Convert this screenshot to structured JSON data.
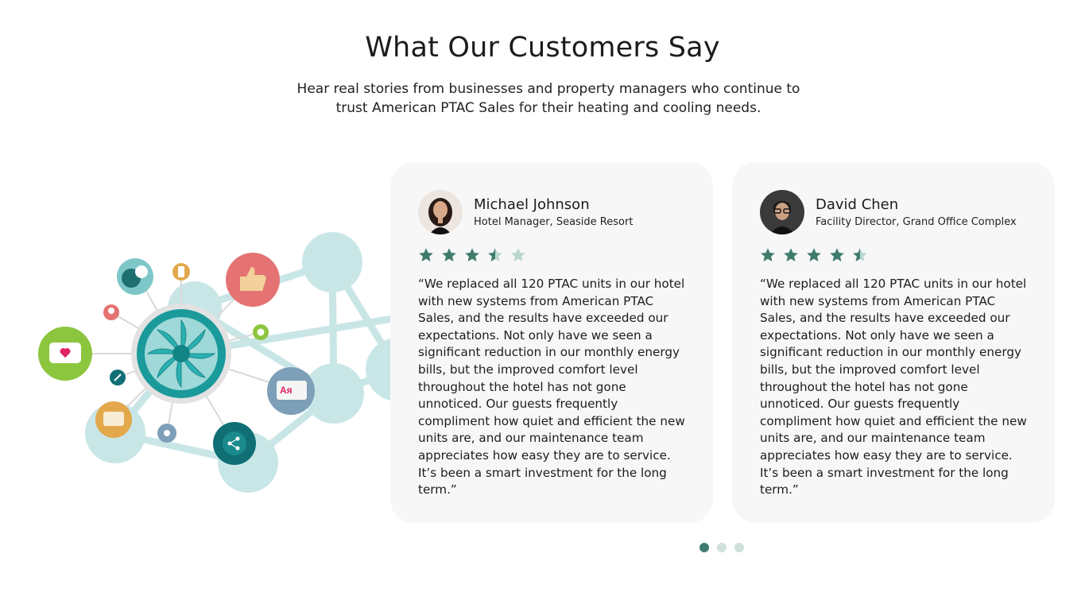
{
  "section": {
    "title": "What Our Customers Say",
    "subtitle": "Hear real stories from businesses and property managers who continue to trust American PTAC Sales for their heating and cooling needs."
  },
  "illustration": {
    "icon": "network-fan-icon",
    "accent_color": "#1a9a9b",
    "node_color": "#c9e6e7"
  },
  "testimonials": [
    {
      "name": "Michael Johnson",
      "role": "Hotel Manager, Seaside Resort",
      "rating": 3.5,
      "rating_max": 5,
      "quote": "“We replaced all 120 PTAC units in our hotel with new systems from American PTAC Sales, and the results have exceeded our expectations. Not only have we seen a significant reduction in our monthly energy bills, but the improved comfort level throughout the hotel has not gone unnoticed. Our guests frequently compliment how quiet and efficient the new units are, and our maintenance team appreciates how easy they are to service. It’s been a smart investment for the long term.”",
      "avatar_icon": "woman-avatar-icon"
    },
    {
      "name": "David Chen",
      "role": "Facility Director, Grand Office Complex",
      "rating": 4.5,
      "rating_max": 5,
      "quote": "“We replaced all 120 PTAC units in our hotel with new systems from American PTAC Sales, and the results have exceeded our expectations. Not only have we seen a significant reduction in our monthly energy bills, but the improved comfort level throughout the hotel has not gone unnoticed. Our guests frequently compliment how quiet and efficient the new units are, and our maintenance team appreciates how easy they are to service. It’s been a smart investment for the long term.”",
      "avatar_icon": "man-avatar-icon"
    }
  ],
  "carousel": {
    "pages": 3,
    "active": 0
  },
  "colors": {
    "star_filled": "#3f7c6e",
    "star_empty": "#b9d7d0",
    "dot_active": "#3f7c6e",
    "dot_inactive": "#cfe1dc",
    "card_bg": "#f7f7f7"
  }
}
